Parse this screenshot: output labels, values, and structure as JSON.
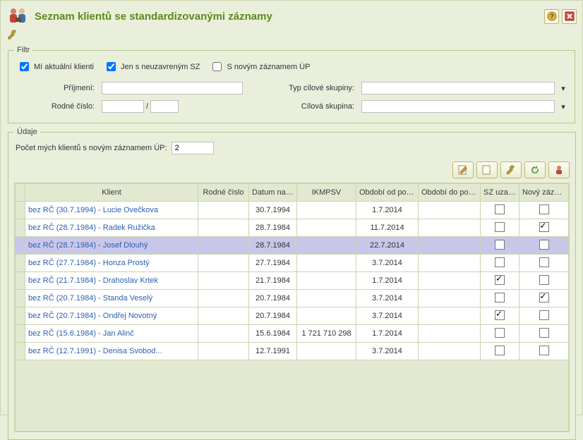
{
  "header": {
    "title": "Seznam klientů se standardizovanými záznamy"
  },
  "filter": {
    "legend": "Filtr",
    "chk_my_clients": "Mí aktuální klienti",
    "chk_open_sz": "Jen s neuzavreným SZ",
    "chk_new_up": "S novým záznamem ÚP",
    "label_surname": "Příjmení:",
    "surname": "",
    "label_rc": "Rodné číslo:",
    "rc_a": "",
    "rc_b": "",
    "rc_sep": "/",
    "label_target_type": "Typ cílové skupiny:",
    "target_type": "",
    "label_target_group": "Cílová skupina:",
    "target_group": ""
  },
  "data": {
    "legend": "Údaje",
    "count_label": "Počet mých klientů s novým záznamem ÚP:",
    "count_value": "2"
  },
  "columns": {
    "klient": "Klient",
    "rc": "Rodné číslo",
    "dob": "Datum narození",
    "ikmpsv": "IKMPSV",
    "od": "Období od posledního SZ",
    "do": "Období do posledního SZ",
    "closed": "SZ uzavřen",
    "newup": "Nový záznam ÚP"
  },
  "rows": [
    {
      "klient": "bez RČ (30.7.1994) - Lucie Ovečkova",
      "rc": "",
      "dob": "30.7.1994",
      "ikmpsv": "",
      "od": "1.7.2014",
      "do": "",
      "closed": false,
      "newup": false
    },
    {
      "klient": "bez RČ (28.7.1984) - Radek Ružička",
      "rc": "",
      "dob": "28.7.1984",
      "ikmpsv": "",
      "od": "11.7.2014",
      "do": "",
      "closed": false,
      "newup": true
    },
    {
      "klient": "bez RČ (28.7.1984) - Josef Dlouhý",
      "rc": "",
      "dob": "28.7.1984",
      "ikmpsv": "",
      "od": "22.7.2014",
      "do": "",
      "closed": false,
      "newup": false,
      "hilite": true
    },
    {
      "klient": "bez RČ (27.7.1984) - Honza Prostý",
      "rc": "",
      "dob": "27.7.1984",
      "ikmpsv": "",
      "od": "3.7.2014",
      "do": "",
      "closed": false,
      "newup": false
    },
    {
      "klient": "bez RČ (21.7.1984) - Drahoslav Krtek",
      "rc": "",
      "dob": "21.7.1984",
      "ikmpsv": "",
      "od": "1.7.2014",
      "do": "",
      "closed": true,
      "newup": false
    },
    {
      "klient": "bez RČ (20.7.1984) - Standa Veselý",
      "rc": "",
      "dob": "20.7.1984",
      "ikmpsv": "",
      "od": "3.7.2014",
      "do": "",
      "closed": false,
      "newup": true
    },
    {
      "klient": "bez RČ (20.7.1984) - Ondřej Novotný",
      "rc": "",
      "dob": "20.7.1984",
      "ikmpsv": "",
      "od": "3.7.2014",
      "do": "",
      "closed": true,
      "newup": false
    },
    {
      "klient": "bez RČ (15.6.1984) - Jan Alinč",
      "rc": "",
      "dob": "15.6.1984",
      "ikmpsv": "1 721 710 298",
      "od": "1.7.2014",
      "do": "",
      "closed": false,
      "newup": false
    },
    {
      "klient": "bez RČ (12.7.1991) - Denisa Svobod...",
      "rc": "",
      "dob": "12.7.1991",
      "ikmpsv": "",
      "od": "3.7.2014",
      "do": "",
      "closed": false,
      "newup": false
    }
  ]
}
